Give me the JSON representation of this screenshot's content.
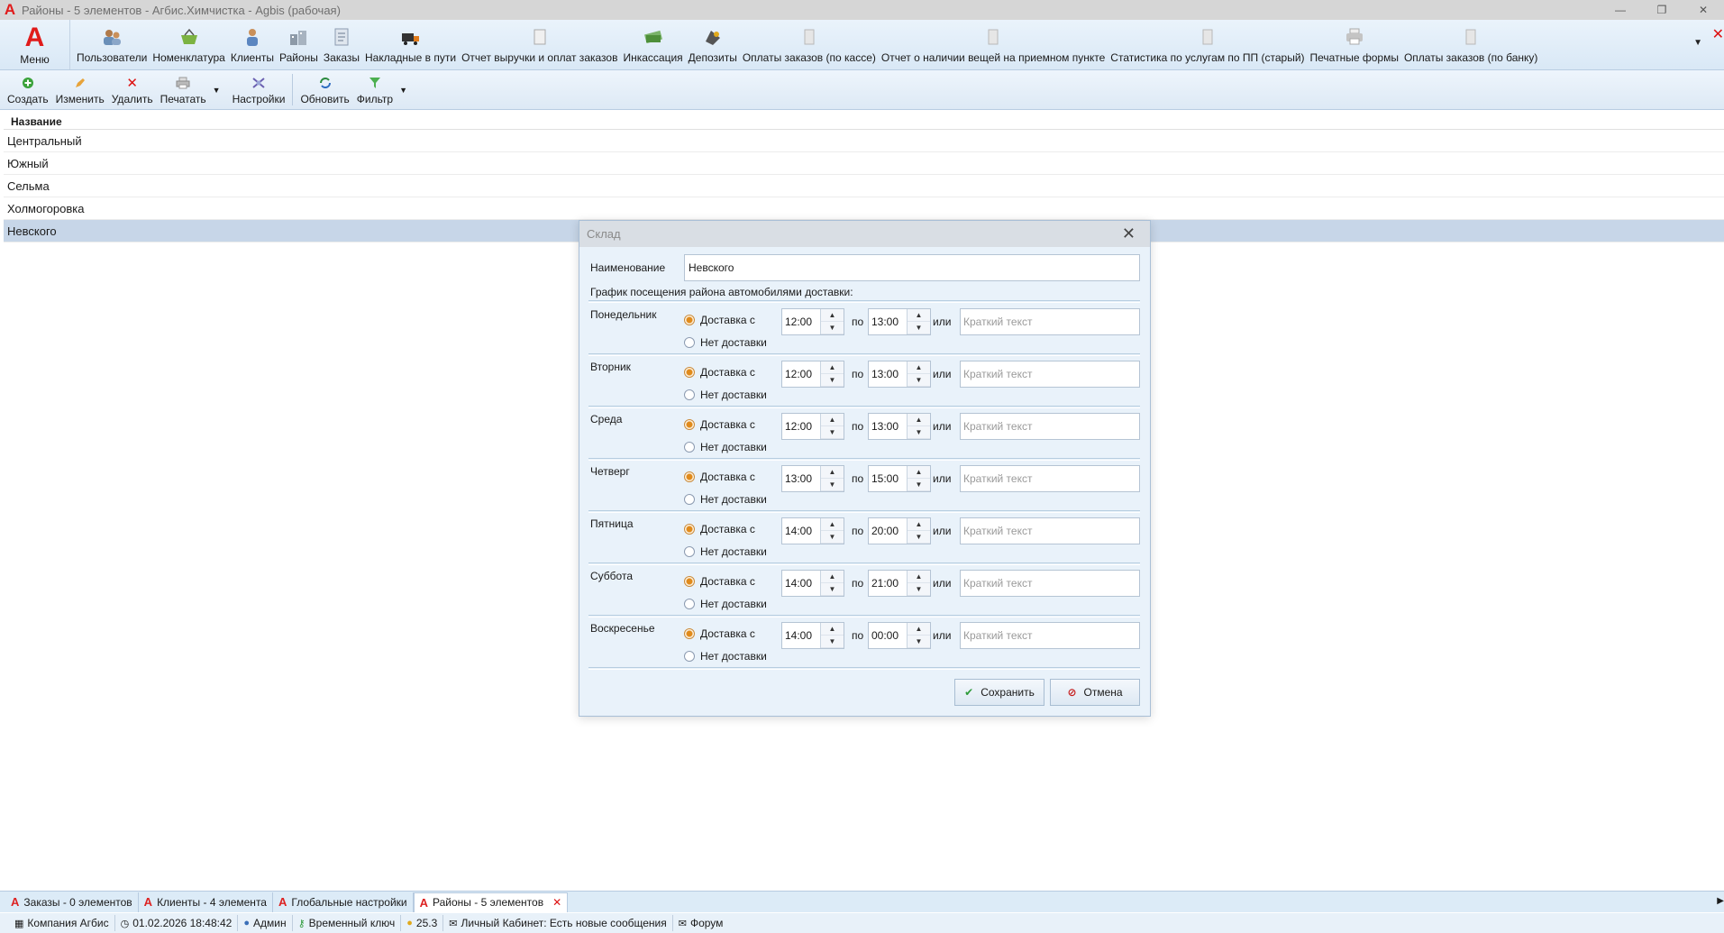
{
  "window": {
    "title": "Районы - 5 элементов - Агбис.Химчистка - Agbis (рабочая)",
    "app_logo": "A"
  },
  "ribbon": {
    "menu_label": "Меню",
    "items": [
      {
        "label": "Пользователи",
        "icon": "users-icon"
      },
      {
        "label": "Номенклатура",
        "icon": "basket-icon"
      },
      {
        "label": "Клиенты",
        "icon": "client-icon"
      },
      {
        "label": "Районы",
        "icon": "districts-icon"
      },
      {
        "label": "Заказы",
        "icon": "orders-icon"
      },
      {
        "label": "Накладные в пути",
        "icon": "truck-icon"
      },
      {
        "label": "Отчет выручки и оплат заказов",
        "icon": "report-icon"
      },
      {
        "label": "Инкассация",
        "icon": "money-icon"
      },
      {
        "label": "Депозиты",
        "icon": "deposit-icon"
      },
      {
        "label": "Оплаты заказов (по кассе)",
        "icon": "document-icon"
      },
      {
        "label": "Отчет о наличии вещей на приемном пункте",
        "icon": "document-icon"
      },
      {
        "label": "Статистика по услугам по ПП (старый)",
        "icon": "document-icon"
      },
      {
        "label": "Печатные формы",
        "icon": "printer-icon"
      },
      {
        "label": "Оплаты заказов (по банку)",
        "icon": "document-icon"
      }
    ]
  },
  "toolbar": {
    "create": "Создать",
    "edit": "Изменить",
    "delete": "Удалить",
    "print": "Печатать",
    "settings": "Настройки",
    "refresh": "Обновить",
    "filter": "Фильтр"
  },
  "grid": {
    "column": "Название",
    "rows": [
      "Центральный",
      "Южный",
      "Сельма",
      "Холмогоровка",
      "Невского"
    ],
    "selected_index": 4
  },
  "dialog": {
    "title": "Склад",
    "name_label": "Наименование",
    "name_value": "Невского",
    "schedule_caption": "График посещения района автомобилями доставки:",
    "delivery_label": "Доставка с",
    "no_delivery_label": "Нет доставки",
    "to_label": "по",
    "or_label": "или",
    "short_text_placeholder": "Краткий текст",
    "days": [
      {
        "name": "Понедельник",
        "from": "12:00",
        "to": "13:00"
      },
      {
        "name": "Вторник",
        "from": "12:00",
        "to": "13:00"
      },
      {
        "name": "Среда",
        "from": "12:00",
        "to": "13:00"
      },
      {
        "name": "Четверг",
        "from": "13:00",
        "to": "15:00"
      },
      {
        "name": "Пятница",
        "from": "14:00",
        "to": "20:00"
      },
      {
        "name": "Суббота",
        "from": "14:00",
        "to": "21:00"
      },
      {
        "name": "Воскресенье",
        "from": "14:00",
        "to": "00:00"
      }
    ],
    "save_label": "Сохранить",
    "cancel_label": "Отмена"
  },
  "tabs": [
    {
      "label": "Заказы - 0 элементов"
    },
    {
      "label": "Клиенты - 4 элемента"
    },
    {
      "label": "Глобальные настройки"
    },
    {
      "label": "Районы - 5 элементов",
      "active": true
    }
  ],
  "status": {
    "company": "Компания Агбис",
    "datetime": "01.02.2026 18:48:42",
    "user": "Админ",
    "key": "Временный ключ",
    "version": "25.3",
    "cabinet": "Личный Кабинет: Есть новые сообщения",
    "forum": "Форум"
  },
  "colors": {
    "accent_red": "#e01b1b",
    "selected_row": "#c7d6e8",
    "radio_checked": "#e08a1b"
  }
}
